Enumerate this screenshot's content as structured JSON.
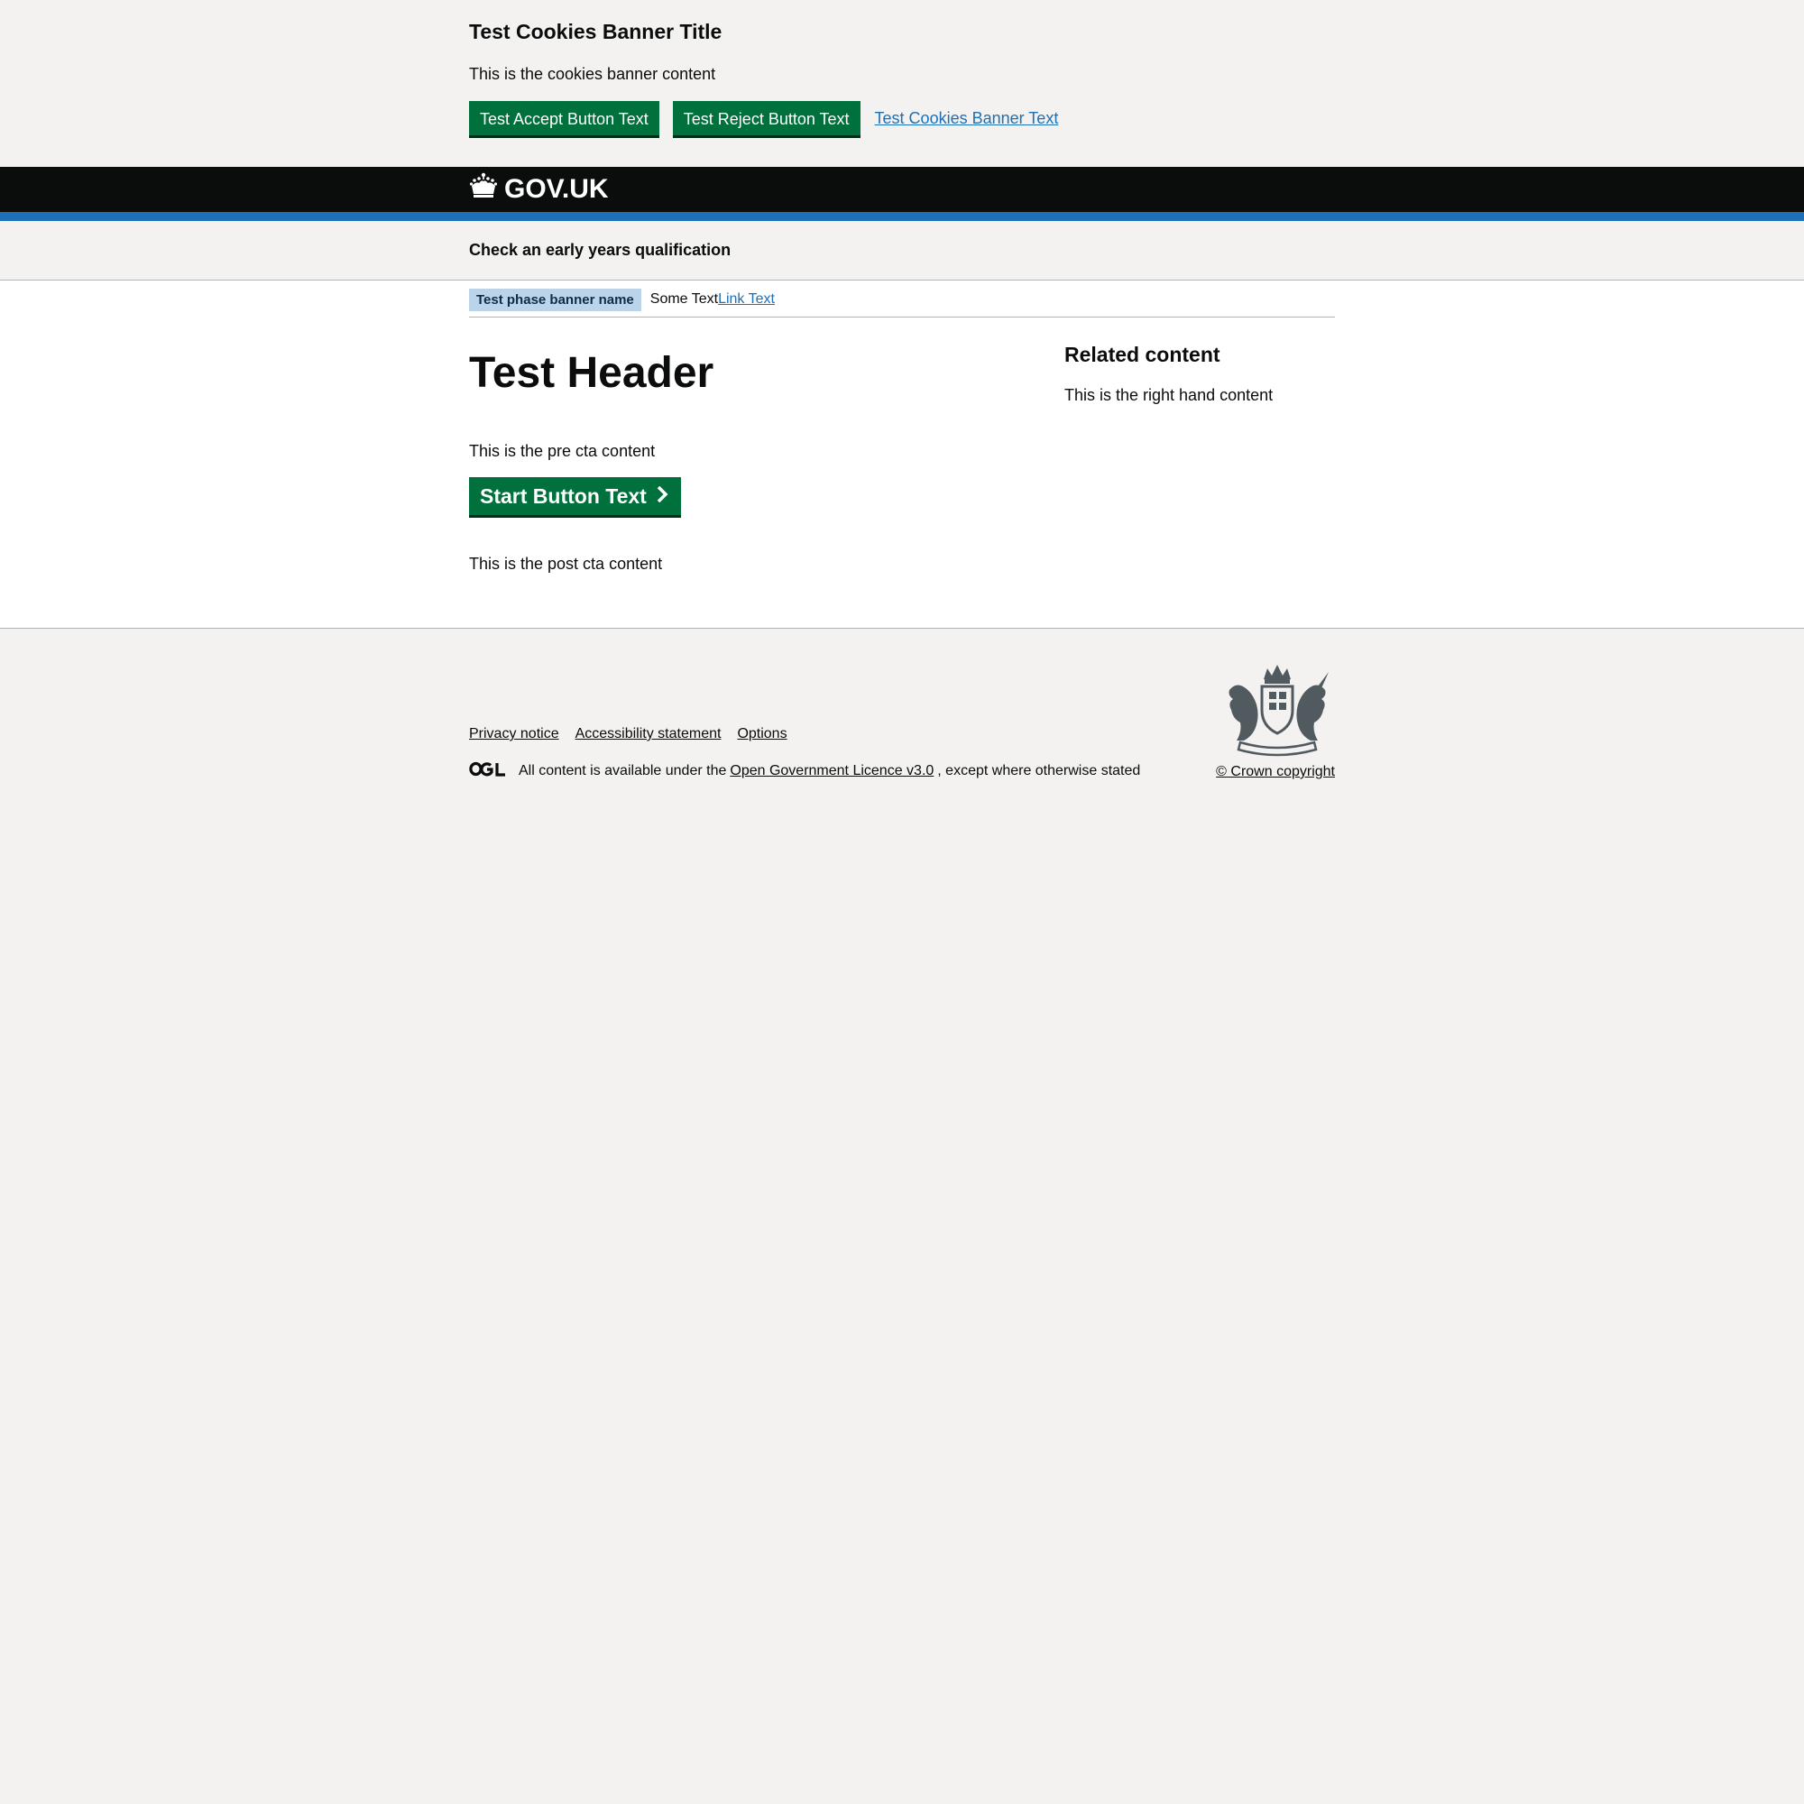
{
  "cookie_banner": {
    "title": "Test Cookies Banner Title",
    "content": "This is the cookies banner content",
    "accept_label": "Test Accept Button Text",
    "reject_label": "Test Reject Button Text",
    "link_text": "Test Cookies Banner Text"
  },
  "header": {
    "logo_text": "GOV.UK",
    "logo_icon": "crown-icon"
  },
  "service": {
    "name": "Check an early years qualification"
  },
  "phase_banner": {
    "tag": "Test phase banner name",
    "text": "Some Text",
    "link_text": "Link Text"
  },
  "main": {
    "header": "Test Header",
    "pre_cta": "This is the pre cta content",
    "start_button": "Start Button Text",
    "post_cta": "This is the post cta content"
  },
  "sidebar": {
    "title": "Related content",
    "content": "This is the right hand content"
  },
  "footer": {
    "links": [
      "Privacy notice",
      "Accessibility statement",
      "Options"
    ],
    "licence_prefix": "All content is available under the",
    "licence_link": "Open Government Licence v3.0",
    "licence_suffix": ", except where otherwise stated",
    "copyright": "© Crown copyright",
    "ogl_icon": "ogl-logo-icon",
    "crest_icon": "royal-coat-of-arms-icon"
  },
  "colors": {
    "brand_green": "#00703c",
    "link_blue": "#1d70b8",
    "header_black": "#0b0c0c",
    "header_stripe": "#1d70b8",
    "background_grey": "#f3f2f1",
    "phase_tag_bg": "#bbd4ea"
  }
}
